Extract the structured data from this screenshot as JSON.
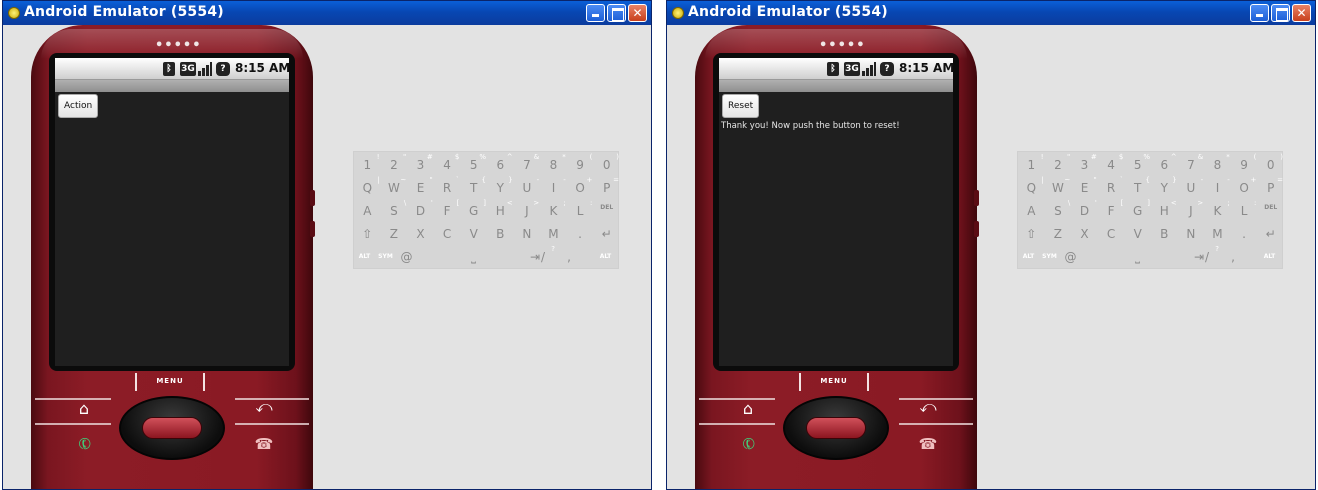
{
  "windows": [
    {
      "title": "Android Emulator (5554)",
      "status_time": "8:15 AM",
      "status_3g": "3G",
      "status_battery": "?",
      "app_button_label": "Action",
      "app_message": "",
      "menu_label": "MENU"
    },
    {
      "title": "Android Emulator (5554)",
      "status_time": "8:15 AM",
      "status_3g": "3G",
      "status_battery": "?",
      "app_button_label": "Reset",
      "app_message": "Thank you! Now push the button to reset!",
      "menu_label": "MENU"
    }
  ],
  "icons": {
    "app": "android-app-icon",
    "minimize": "minimize-icon",
    "maximize": "maximize-icon",
    "close": "close-icon",
    "bluetooth": "bluetooth-icon",
    "signal": "signal-strength-icon",
    "battery": "battery-icon",
    "home": "home-icon",
    "back": "back-icon",
    "call": "call-icon",
    "end_call": "end-call-icon"
  },
  "keyboard": {
    "row1": [
      {
        "k": "1",
        "s": "!"
      },
      {
        "k": "2",
        "s": "\""
      },
      {
        "k": "3",
        "s": "#"
      },
      {
        "k": "4",
        "s": "$"
      },
      {
        "k": "5",
        "s": "%"
      },
      {
        "k": "6",
        "s": "^"
      },
      {
        "k": "7",
        "s": "&"
      },
      {
        "k": "8",
        "s": "*"
      },
      {
        "k": "9",
        "s": "("
      },
      {
        "k": "0",
        "s": ")"
      }
    ],
    "row2": [
      {
        "k": "Q",
        "s": "|"
      },
      {
        "k": "W",
        "s": "~"
      },
      {
        "k": "E",
        "s": "\""
      },
      {
        "k": "R",
        "s": "`"
      },
      {
        "k": "T",
        "s": "{"
      },
      {
        "k": "Y",
        "s": "}"
      },
      {
        "k": "U",
        "s": "-"
      },
      {
        "k": "I",
        "s": "-"
      },
      {
        "k": "O",
        "s": "+"
      },
      {
        "k": "P",
        "s": "="
      }
    ],
    "row3": [
      {
        "k": "A",
        "s": ""
      },
      {
        "k": "S",
        "s": "\\"
      },
      {
        "k": "D",
        "s": "'"
      },
      {
        "k": "F",
        "s": "["
      },
      {
        "k": "G",
        "s": "]"
      },
      {
        "k": "H",
        "s": "<"
      },
      {
        "k": "J",
        "s": ">"
      },
      {
        "k": "K",
        "s": ";"
      },
      {
        "k": "L",
        "s": ":"
      },
      {
        "k": "DEL",
        "s": ""
      }
    ],
    "row4": [
      {
        "k": "⇧",
        "s": ""
      },
      {
        "k": "Z",
        "s": ""
      },
      {
        "k": "X",
        "s": ""
      },
      {
        "k": "C",
        "s": ""
      },
      {
        "k": "V",
        "s": ""
      },
      {
        "k": "B",
        "s": ""
      },
      {
        "k": "N",
        "s": ""
      },
      {
        "k": "M",
        "s": ""
      },
      {
        "k": ".",
        "s": ""
      },
      {
        "k": "↵",
        "s": ""
      }
    ],
    "row5": [
      {
        "k": "ALT",
        "s": ""
      },
      {
        "k": "SYM",
        "s": ""
      },
      {
        "k": "@",
        "s": ""
      },
      {
        "k": "⎵",
        "s": ""
      },
      {
        "k": "⇥",
        "s": ""
      },
      {
        "k": "/",
        "s": "?"
      },
      {
        "k": ",",
        "s": ""
      },
      {
        "k": "ALT",
        "s": ""
      }
    ]
  }
}
